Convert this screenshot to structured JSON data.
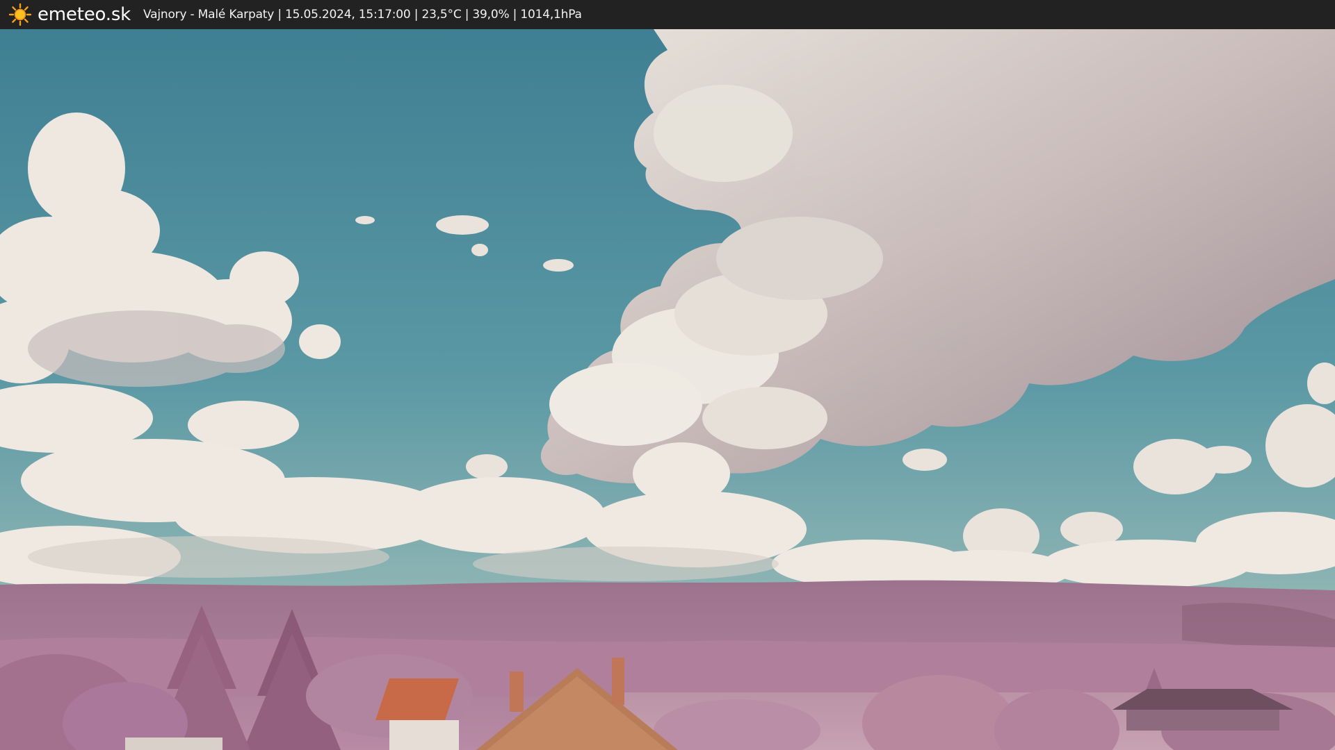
{
  "header": {
    "brand": "emeteo.sk",
    "logo_icon": "sun-icon",
    "caption": "Vajnory - Malé Karpaty | 15.05.2024, 15:17:00 | 23,5°C | 39,0% | 1014,1hPa"
  },
  "colors": {
    "bar_background": "#222222",
    "sky_top": "#3f7f93",
    "sky_bottom": "#6fa8ae",
    "vegetation": "#b88aa5",
    "roof": "#c86a48"
  }
}
